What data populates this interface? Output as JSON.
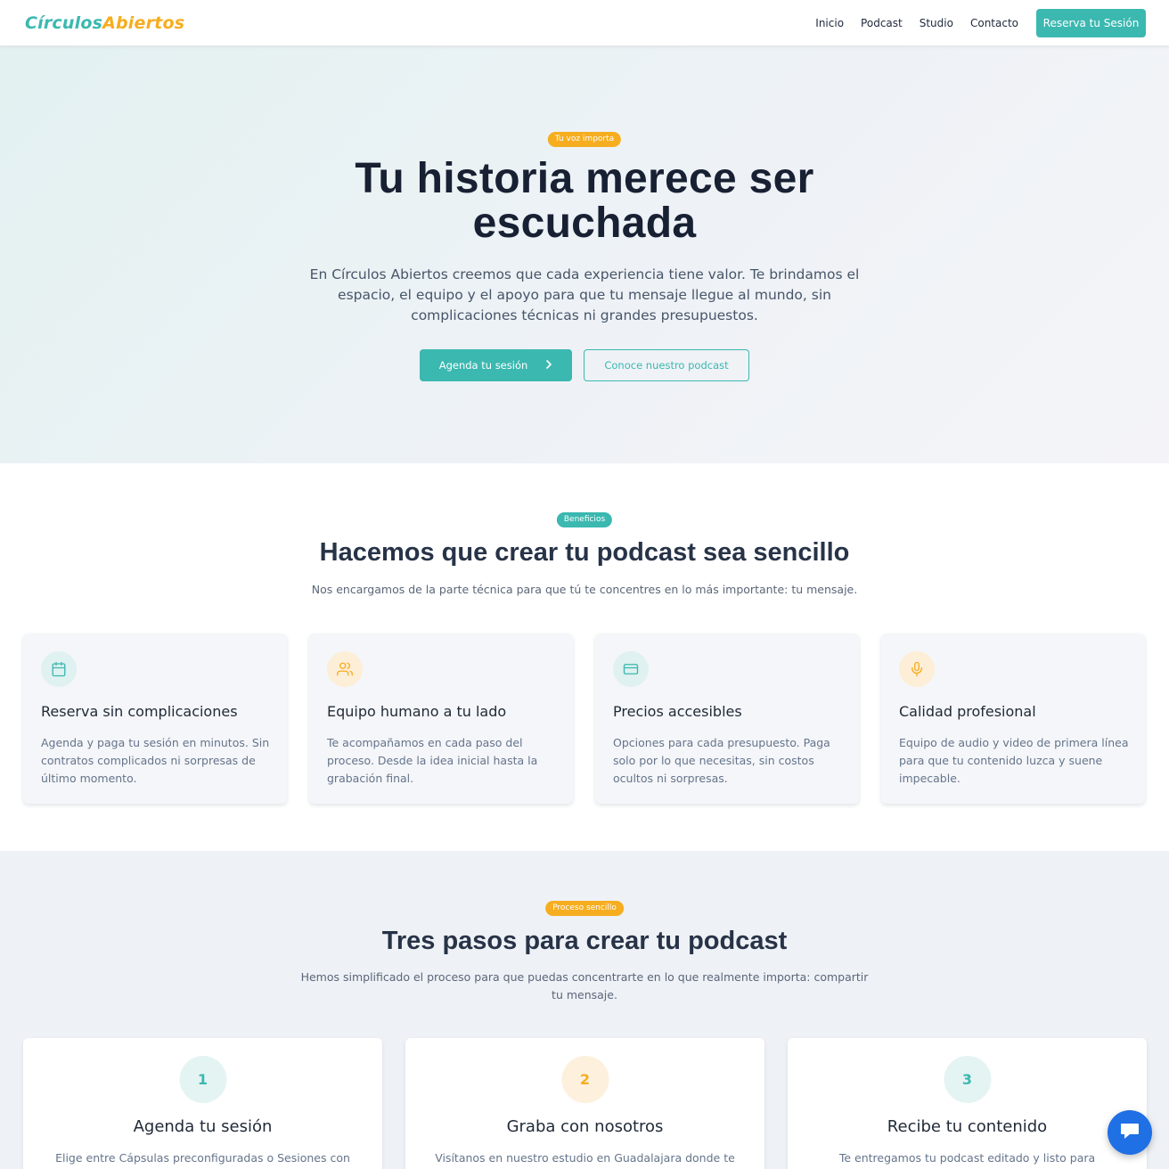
{
  "header": {
    "logo_part1": "Círculos",
    "logo_part2": "Abiertos",
    "nav": [
      "Inicio",
      "Podcast",
      "Studio",
      "Contacto"
    ],
    "cta": "Reserva tu Sesión"
  },
  "hero": {
    "badge": "Tu voz importa",
    "title_line1": "Tu historia merece ser",
    "title_line2": "escuchada",
    "description": "En Círculos Abiertos creemos que cada experiencia tiene valor. Te brindamos el espacio, el equipo y el apoyo para que tu mensaje llegue al mundo, sin complicaciones técnicas ni grandes presupuestos.",
    "primary_button": "Agenda tu sesión",
    "secondary_button": "Conoce nuestro podcast"
  },
  "benefits": {
    "badge": "Beneficios",
    "title": "Hacemos que crear tu podcast sea sencillo",
    "subtitle": "Nos encargamos de la parte técnica para que tú te concentres en lo más importante: tu mensaje.",
    "cards": [
      {
        "icon": "calendar-icon",
        "title": "Reserva sin complicaciones",
        "text": "Agenda y paga tu sesión en minutos. Sin contratos complicados ni sorpresas de último momento."
      },
      {
        "icon": "users-icon",
        "title": "Equipo humano a tu lado",
        "text": "Te acompañamos en cada paso del proceso. Desde la idea inicial hasta la grabación final."
      },
      {
        "icon": "credit-card-icon",
        "title": "Precios accesibles",
        "text": "Opciones para cada presupuesto. Paga solo por lo que necesitas, sin costos ocultos ni sorpresas."
      },
      {
        "icon": "microphone-icon",
        "title": "Calidad profesional",
        "text": "Equipo de audio y video de primera línea para que tu contenido luzca y suene impecable."
      }
    ]
  },
  "steps": {
    "badge": "Proceso sencillo",
    "title": "Tres pasos para crear tu podcast",
    "subtitle": "Hemos simplificado el proceso para que puedas concentrarte en lo que realmente importa: compartir tu mensaje.",
    "cards": [
      {
        "num": "1",
        "title": "Agenda tu sesión",
        "text": "Elige entre Cápsulas preconfiguradas o Sesiones con"
      },
      {
        "num": "2",
        "title": "Graba con nosotros",
        "text": "Visítanos en nuestro estudio en Guadalajara donde te"
      },
      {
        "num": "3",
        "title": "Recibe tu contenido",
        "text": "Te entregamos tu podcast editado y listo para compartir"
      }
    ]
  },
  "colors": {
    "teal": "#3bb8b0",
    "orange": "#f6ad1f",
    "chat_blue": "#1f6fe5"
  },
  "chat": {
    "icon": "chat-bubble-icon"
  }
}
